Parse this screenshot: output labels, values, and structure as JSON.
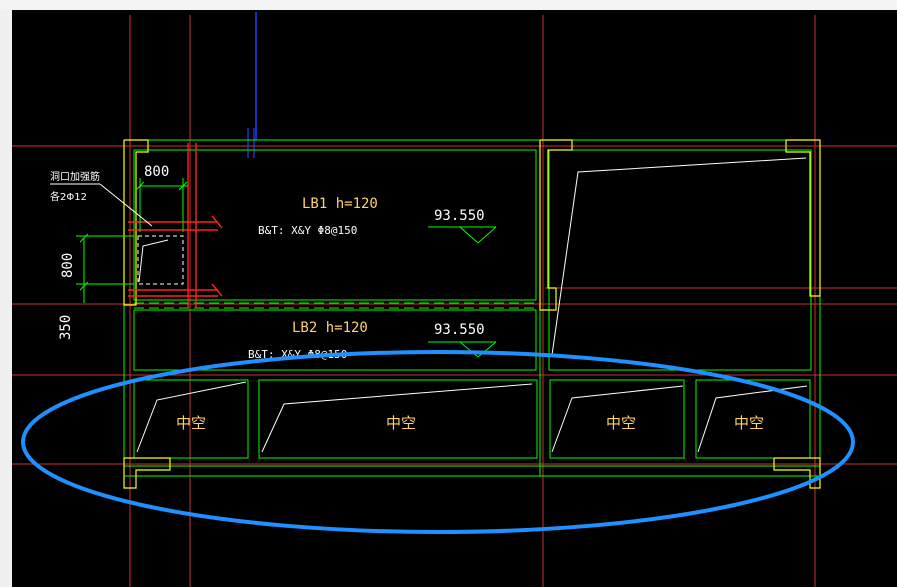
{
  "drawing": {
    "slab1": {
      "name": "LB1 h=120",
      "reinforcement": "B&T: X&Y Φ8@150",
      "elevation": "93.550"
    },
    "slab2": {
      "name": "LB2 h=120",
      "reinforcement": "B&T: X&Y Φ8@150",
      "elevation": "93.550"
    },
    "opening": {
      "note_line1": "洞口加强筋",
      "note_line2": "各2Φ12",
      "width_dim": "800",
      "height_dim": "800"
    },
    "side_dim": "350",
    "hollow_label": "中空"
  },
  "colors": {
    "background": "#000000",
    "grid_axis": "#ff3b3b",
    "beam": "#00ff00",
    "column": "#ffff00",
    "rebar": "#ff2020",
    "text": "#ffffff",
    "label": "#ffd36b",
    "highlight_ellipse": "#1e90ff",
    "blue_axis": "#2040ff"
  },
  "icons": {
    "elevation_marker": "triangle-down-icon"
  }
}
